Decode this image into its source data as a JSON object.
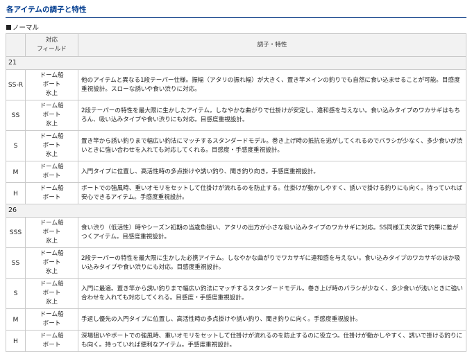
{
  "page": {
    "title": "各アイテムの調子と特性",
    "subheading": "ノーマル"
  },
  "table": {
    "header": {
      "field_line1": "対応",
      "field_line2": "フィールド",
      "spec": "調子・特性"
    },
    "groups": [
      {
        "label": "21",
        "rows": [
          {
            "model": "SS-R",
            "fields": [
              "ドーム船",
              "ボート",
              "氷上"
            ],
            "desc": "他のアイテムと異なる1段テーパー仕様。振幅（アタリの振れ幅）が大きく、置き竿メインの釣りでも自然に食い込ませることが可能。目感度重視設計。スローな誘いや食い渋りに対応。"
          },
          {
            "model": "SS",
            "fields": [
              "ドーム船",
              "ボート",
              "氷上"
            ],
            "desc": "2段テーパーの特性を最大限に生かしたアイテム。しなやかな曲がりで仕掛けが安定し、違和感を与えない。食い込みタイプのワカサギはもちろん、吸い込みタイプや食い渋りにも対応。目感度重視設計。"
          },
          {
            "model": "S",
            "fields": [
              "ドーム船",
              "ボート",
              "氷上"
            ],
            "desc": "置き竿から誘い釣りまで幅広い釣法にマッチするスタンダードモデル。巻き上げ時の抵抗を逃がしてくれるのでバラシが少なく、多少食いが渋いときに強い合わせを入れても対応してくれる。目感度・手感度重視設計。"
          },
          {
            "model": "M",
            "fields": [
              "ドーム船",
              "ボート"
            ],
            "desc": "入門タイプに位置し、高活性時の多点掛けや誘い釣り、聞き釣り向き。手感度重視設計。"
          },
          {
            "model": "H",
            "fields": [
              "ドーム船",
              "ボート"
            ],
            "desc": "ボートでの強風時、重いオモリをセットして仕掛けが流れるのを防止する。仕掛けが動かしやすく、誘いで掛ける釣りにも向く。持っていれば安心できるアイテム。手感度重視設計。"
          }
        ]
      },
      {
        "label": "26",
        "rows": [
          {
            "model": "SSS",
            "fields": [
              "ドーム船",
              "ボート",
              "氷上"
            ],
            "desc": "食い渋り（低活性）時やシーズン初期の当歳魚狙い、アタリの出方が小さな吸い込みタイプのワカサギに対応。SS同様工夫次第で釣果に差がつくアイテム。目感度重視設計。"
          },
          {
            "model": "SS",
            "fields": [
              "ドーム船",
              "ボート",
              "氷上"
            ],
            "desc": "2段テーパーの特性を最大限に生かした必携アイテム。しなやかな曲がりでワカサギに違和感を与えない。食い込みタイプのワカサギのほか吸い込みタイプや食い渋りにも対応。目感度重視設計。"
          },
          {
            "model": "S",
            "fields": [
              "ドーム船",
              "ボート",
              "氷上"
            ],
            "desc": "入門に最適。置き竿から誘い釣りまで幅広い釣法にマッチするスタンダードモデル。巻き上げ時のバラシが少なく、多少食いが浅いときに強い合わせを入れても対応してくれる。目感度・手感度重視設計。"
          },
          {
            "model": "M",
            "fields": [
              "ドーム船",
              "ボート"
            ],
            "desc": "手返し優先の入門タイプに位置し、高活性時の多点掛けや誘い釣り、聞き釣りに向く。手感度重視設計。"
          },
          {
            "model": "H",
            "fields": [
              "ドーム船",
              "ボート"
            ],
            "desc": "深場狙いやボートでの強風時、重いオモリをセットして仕掛けが流れるのを防止するのに役立つ。仕掛けが動かしやすく、誘いで掛ける釣りにも向く。持っていれば便利なアイテム。手感度重視設計。"
          }
        ]
      }
    ]
  }
}
